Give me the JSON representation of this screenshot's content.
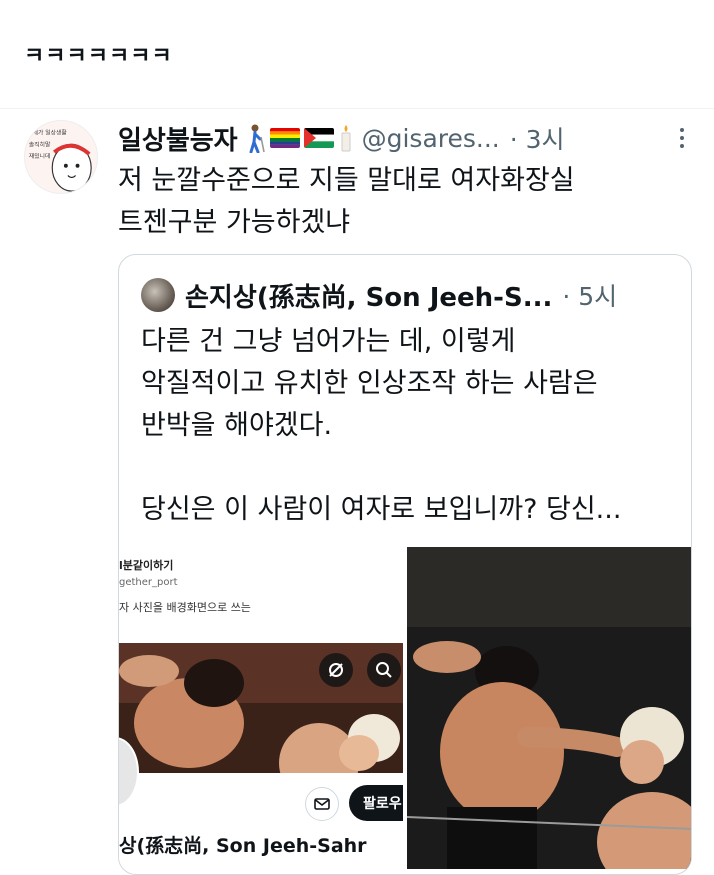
{
  "top": {
    "text": "ㅋㅋㅋㅋㅋㅋㅋ"
  },
  "tweet": {
    "display_name": "일상불능자",
    "handle": "@gisares...",
    "time": "· 3시",
    "body_lines": [
      "저 눈깔수준으로 지들 말대로 여자화장실",
      "트젠구분 가능하겠냐"
    ],
    "emojis": [
      "person-with-cane-icon",
      "rainbow-flag-icon",
      "palestine-flag-icon",
      "candle-icon"
    ]
  },
  "quote": {
    "display_name": "손지상(孫志尚, Son Jeeh-S...",
    "time": "· 5시",
    "body": "다른 건 그냥 넘어가는 데, 이렇게\n악질적이고 유치한 인상조작 하는 사람은\n반박을 해야겠다.\n\n당신은 이 사람이 여자로 보입니까? 당신..."
  },
  "screenshot": {
    "title": "l분같이하기",
    "handle": "gether_port",
    "desc": "자 사진을 배경화면으로 쓰는",
    "follow_label": "팔로우",
    "name": "상(孫志尚, Son Jeeh-Sahr"
  },
  "colors": {
    "text": "#0f1419",
    "secondary": "#536471",
    "border": "#cfd9de"
  }
}
